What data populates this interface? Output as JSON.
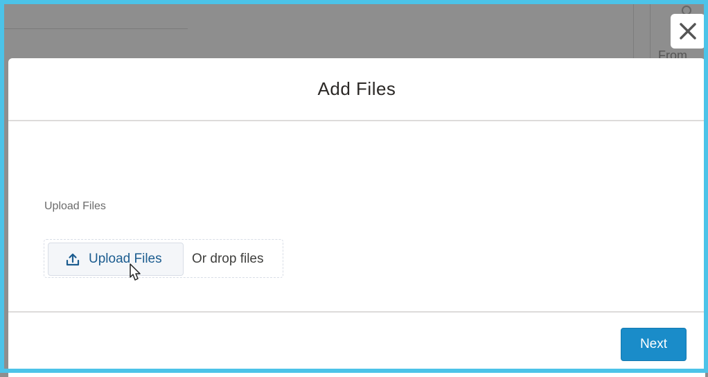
{
  "background": {
    "label_from": "From"
  },
  "modal": {
    "title": "Add Files",
    "field_label": "Upload Files",
    "upload_button_label": "Upload Files",
    "drop_text": "Or drop files",
    "next_label": "Next"
  },
  "icons": {
    "close": "close-icon",
    "upload": "upload-icon",
    "cursor": "mouse-pointer-icon"
  },
  "colors": {
    "frame": "#4cc3e8",
    "overlay": "#8e8e8e",
    "link": "#1b5c8f",
    "brand_button": "#1a8cc9"
  }
}
